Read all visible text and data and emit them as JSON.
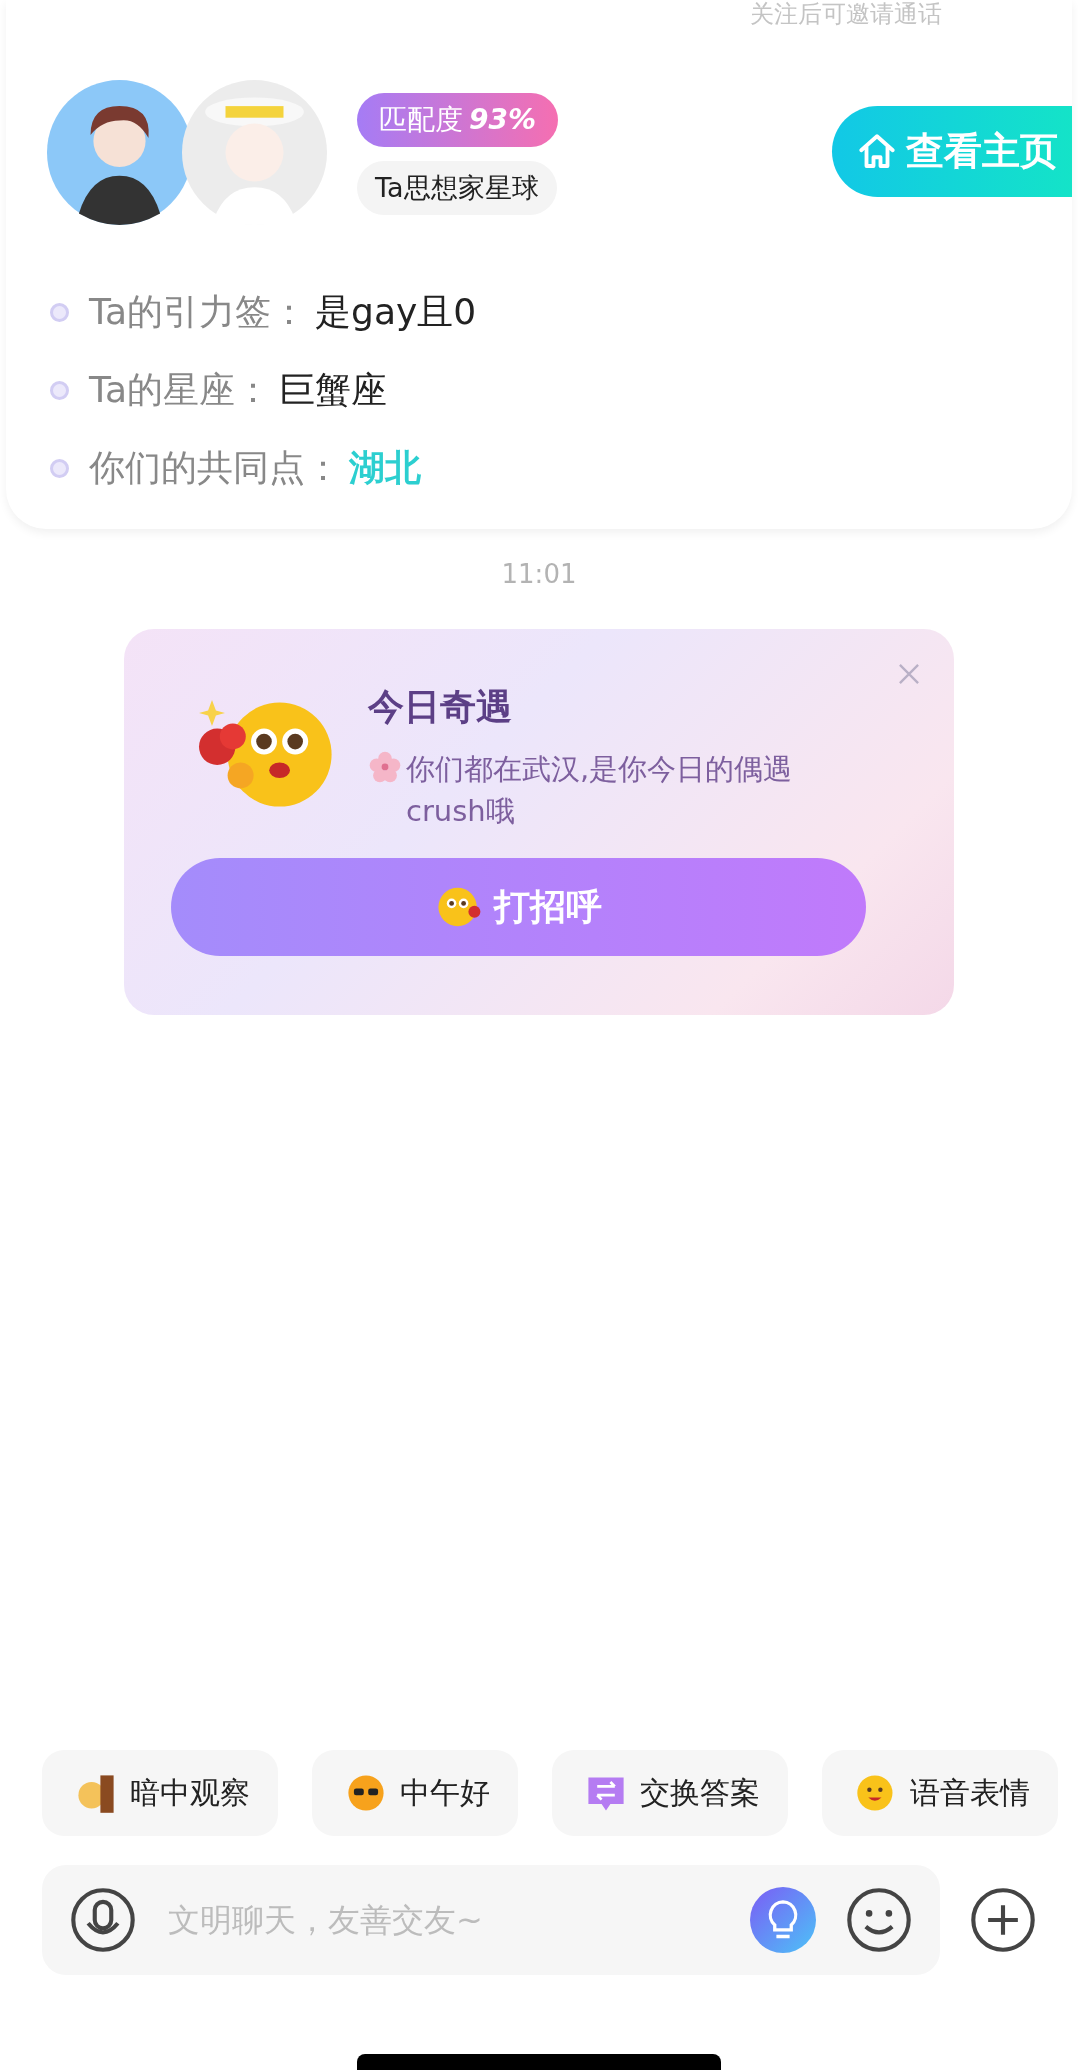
{
  "header_note": "关注后可邀请通话",
  "profile": {
    "match_badge": {
      "label": "匹配度",
      "value": "93%"
    },
    "planet_tag": "Ta思想家星球",
    "home_button": "查看主页",
    "facts": [
      {
        "label": "Ta的引力签：",
        "value": "是gay且0",
        "highlight": false
      },
      {
        "label": "Ta的星座：",
        "value": "巨蟹座",
        "highlight": false
      },
      {
        "label": "你们的共同点：",
        "value": "湖北",
        "highlight": true
      }
    ]
  },
  "timestamp": "11:01",
  "encounter_card": {
    "title": "今日奇遇",
    "message": "你们都在武汉,是你今日的偶遇crush哦",
    "button": "打招呼"
  },
  "quick_replies": [
    {
      "label": "暗中观察"
    },
    {
      "label": "中午好"
    },
    {
      "label": "交换答案"
    },
    {
      "label": "语音表情"
    }
  ],
  "composer": {
    "placeholder": "文明聊天，友善交友~"
  }
}
